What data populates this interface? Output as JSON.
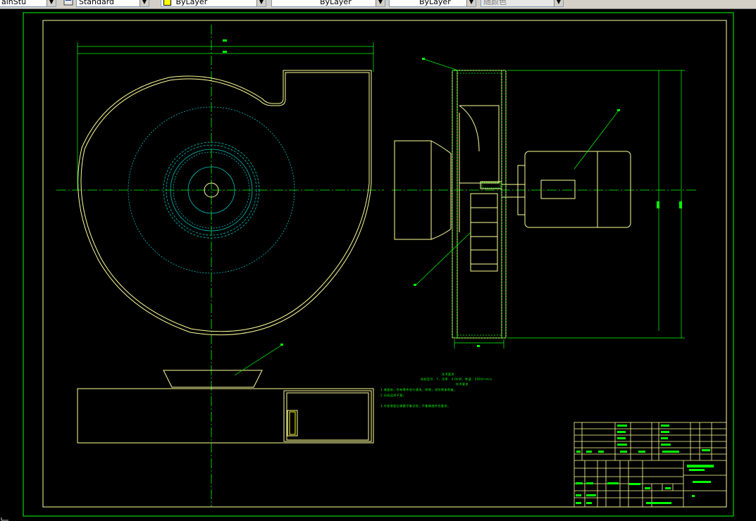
{
  "toolbar": {
    "textstyle_combo": {
      "value": "Standard"
    },
    "linetype_color_combo": {
      "value": "ByLayer"
    },
    "linetype_combo": {
      "value": "ByLayer"
    },
    "lineweight_combo": {
      "value": "ByLayer"
    },
    "plotstyle_combo": {
      "value": "随颜色"
    }
  },
  "colors": {
    "background": "#000000",
    "border": "#00ff00",
    "outline": "#ffff99",
    "centerline": "#00ff00",
    "hidden": "#00c0c0",
    "dimension": "#00ff00",
    "annotation": "#00ff00"
  },
  "drawing": {
    "notes_title": "技术要求",
    "notes_lines": [
      "电机型号：Y，功率：4.0kW，转速：2900r/min",
      "技术要求",
      "1.装配前，所有零件进行清洗、除锈，涂防锈漆两遍。",
      "2.风机运转平稳。",
      "3.叶轮装配后做静平衡试验，平衡精度符合要求。"
    ]
  }
}
